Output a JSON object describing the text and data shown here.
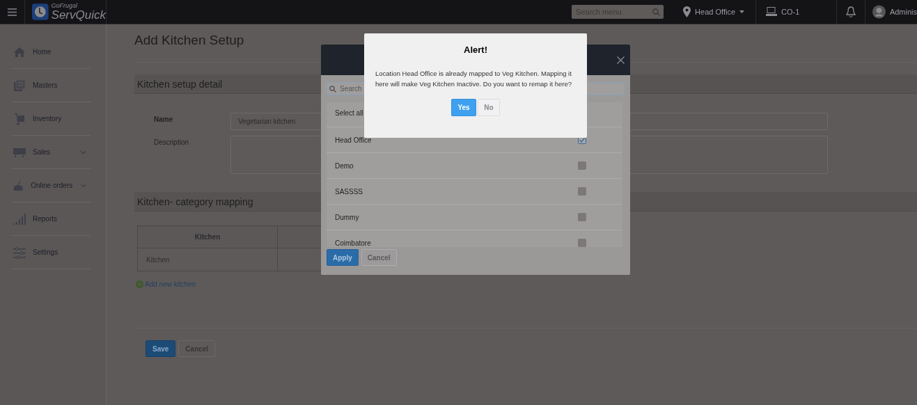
{
  "topbar": {
    "logo": {
      "brand": "GoFrugal",
      "product": "ServQuick"
    },
    "search": {
      "placeholder": "Search menu"
    },
    "location": "Head Office",
    "terminal": "CO-1",
    "user": "Adminis"
  },
  "sidebar": {
    "items": [
      {
        "label": "Home",
        "kind": "home",
        "has_submenu": false
      },
      {
        "label": "Masters",
        "kind": "masters",
        "has_submenu": false
      },
      {
        "label": "Inventory",
        "kind": "inventory",
        "has_submenu": false
      },
      {
        "label": "Sales",
        "kind": "sales",
        "has_submenu": true
      },
      {
        "label": "Online orders",
        "kind": "online",
        "has_submenu": true
      },
      {
        "label": "Reports",
        "kind": "reports",
        "has_submenu": false
      },
      {
        "label": "Settings",
        "kind": "settings",
        "has_submenu": false
      }
    ]
  },
  "page": {
    "title": "Add Kitchen Setup",
    "detail_section": {
      "title": "Kitchen setup detail",
      "name_label": "Name",
      "name_value": "Vegetarian kitchen",
      "description_label": "Description"
    },
    "mapping_section": {
      "title": "Kitchen- category mapping",
      "table": {
        "columns": [
          "Kitchen"
        ],
        "rows": [
          [
            "Kitchen"
          ]
        ]
      },
      "add_link": "Add new kitchen"
    },
    "buttons": [
      "Save",
      "Cancel"
    ]
  },
  "location_picker": {
    "search": {
      "placeholder": "Search"
    },
    "select_all": "Select all",
    "rows": [
      {
        "label": "Head Office",
        "checked": true
      },
      {
        "label": "Demo",
        "checked": false
      },
      {
        "label": "SASSSS",
        "checked": false
      },
      {
        "label": "Dummy",
        "checked": false
      },
      {
        "label": "Coimbatore",
        "checked": false
      }
    ],
    "buttons": [
      "Apply",
      "Cancel"
    ]
  },
  "alert": {
    "title": "Alert!",
    "message": "Location Head Office is already mapped to Veg Kitchen. Mapping it here will make Veg Kitchen Inactive. Do you want to remap it here?",
    "buttons": [
      "Yes",
      "No"
    ]
  }
}
